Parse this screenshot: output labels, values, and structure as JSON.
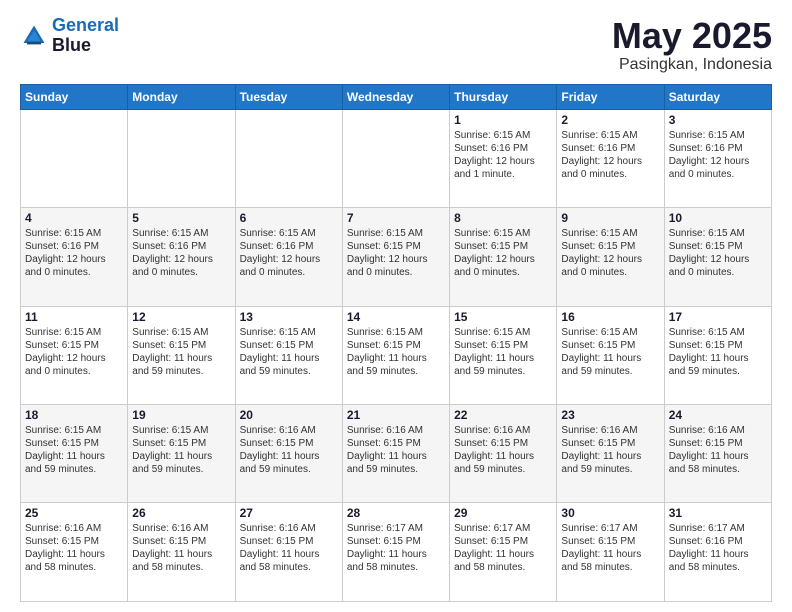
{
  "logo": {
    "line1": "General",
    "line2": "Blue"
  },
  "header": {
    "title": "May 2025",
    "subtitle": "Pasingkan, Indonesia"
  },
  "days_of_week": [
    "Sunday",
    "Monday",
    "Tuesday",
    "Wednesday",
    "Thursday",
    "Friday",
    "Saturday"
  ],
  "weeks": [
    [
      {
        "day": "",
        "info": ""
      },
      {
        "day": "",
        "info": ""
      },
      {
        "day": "",
        "info": ""
      },
      {
        "day": "",
        "info": ""
      },
      {
        "day": "1",
        "info": "Sunrise: 6:15 AM\nSunset: 6:16 PM\nDaylight: 12 hours and 1 minute."
      },
      {
        "day": "2",
        "info": "Sunrise: 6:15 AM\nSunset: 6:16 PM\nDaylight: 12 hours and 0 minutes."
      },
      {
        "day": "3",
        "info": "Sunrise: 6:15 AM\nSunset: 6:16 PM\nDaylight: 12 hours and 0 minutes."
      }
    ],
    [
      {
        "day": "4",
        "info": "Sunrise: 6:15 AM\nSunset: 6:16 PM\nDaylight: 12 hours and 0 minutes."
      },
      {
        "day": "5",
        "info": "Sunrise: 6:15 AM\nSunset: 6:16 PM\nDaylight: 12 hours and 0 minutes."
      },
      {
        "day": "6",
        "info": "Sunrise: 6:15 AM\nSunset: 6:16 PM\nDaylight: 12 hours and 0 minutes."
      },
      {
        "day": "7",
        "info": "Sunrise: 6:15 AM\nSunset: 6:15 PM\nDaylight: 12 hours and 0 minutes."
      },
      {
        "day": "8",
        "info": "Sunrise: 6:15 AM\nSunset: 6:15 PM\nDaylight: 12 hours and 0 minutes."
      },
      {
        "day": "9",
        "info": "Sunrise: 6:15 AM\nSunset: 6:15 PM\nDaylight: 12 hours and 0 minutes."
      },
      {
        "day": "10",
        "info": "Sunrise: 6:15 AM\nSunset: 6:15 PM\nDaylight: 12 hours and 0 minutes."
      }
    ],
    [
      {
        "day": "11",
        "info": "Sunrise: 6:15 AM\nSunset: 6:15 PM\nDaylight: 12 hours and 0 minutes."
      },
      {
        "day": "12",
        "info": "Sunrise: 6:15 AM\nSunset: 6:15 PM\nDaylight: 11 hours and 59 minutes."
      },
      {
        "day": "13",
        "info": "Sunrise: 6:15 AM\nSunset: 6:15 PM\nDaylight: 11 hours and 59 minutes."
      },
      {
        "day": "14",
        "info": "Sunrise: 6:15 AM\nSunset: 6:15 PM\nDaylight: 11 hours and 59 minutes."
      },
      {
        "day": "15",
        "info": "Sunrise: 6:15 AM\nSunset: 6:15 PM\nDaylight: 11 hours and 59 minutes."
      },
      {
        "day": "16",
        "info": "Sunrise: 6:15 AM\nSunset: 6:15 PM\nDaylight: 11 hours and 59 minutes."
      },
      {
        "day": "17",
        "info": "Sunrise: 6:15 AM\nSunset: 6:15 PM\nDaylight: 11 hours and 59 minutes."
      }
    ],
    [
      {
        "day": "18",
        "info": "Sunrise: 6:15 AM\nSunset: 6:15 PM\nDaylight: 11 hours and 59 minutes."
      },
      {
        "day": "19",
        "info": "Sunrise: 6:15 AM\nSunset: 6:15 PM\nDaylight: 11 hours and 59 minutes."
      },
      {
        "day": "20",
        "info": "Sunrise: 6:16 AM\nSunset: 6:15 PM\nDaylight: 11 hours and 59 minutes."
      },
      {
        "day": "21",
        "info": "Sunrise: 6:16 AM\nSunset: 6:15 PM\nDaylight: 11 hours and 59 minutes."
      },
      {
        "day": "22",
        "info": "Sunrise: 6:16 AM\nSunset: 6:15 PM\nDaylight: 11 hours and 59 minutes."
      },
      {
        "day": "23",
        "info": "Sunrise: 6:16 AM\nSunset: 6:15 PM\nDaylight: 11 hours and 59 minutes."
      },
      {
        "day": "24",
        "info": "Sunrise: 6:16 AM\nSunset: 6:15 PM\nDaylight: 11 hours and 58 minutes."
      }
    ],
    [
      {
        "day": "25",
        "info": "Sunrise: 6:16 AM\nSunset: 6:15 PM\nDaylight: 11 hours and 58 minutes."
      },
      {
        "day": "26",
        "info": "Sunrise: 6:16 AM\nSunset: 6:15 PM\nDaylight: 11 hours and 58 minutes."
      },
      {
        "day": "27",
        "info": "Sunrise: 6:16 AM\nSunset: 6:15 PM\nDaylight: 11 hours and 58 minutes."
      },
      {
        "day": "28",
        "info": "Sunrise: 6:17 AM\nSunset: 6:15 PM\nDaylight: 11 hours and 58 minutes."
      },
      {
        "day": "29",
        "info": "Sunrise: 6:17 AM\nSunset: 6:15 PM\nDaylight: 11 hours and 58 minutes."
      },
      {
        "day": "30",
        "info": "Sunrise: 6:17 AM\nSunset: 6:15 PM\nDaylight: 11 hours and 58 minutes."
      },
      {
        "day": "31",
        "info": "Sunrise: 6:17 AM\nSunset: 6:16 PM\nDaylight: 11 hours and 58 minutes."
      }
    ]
  ]
}
